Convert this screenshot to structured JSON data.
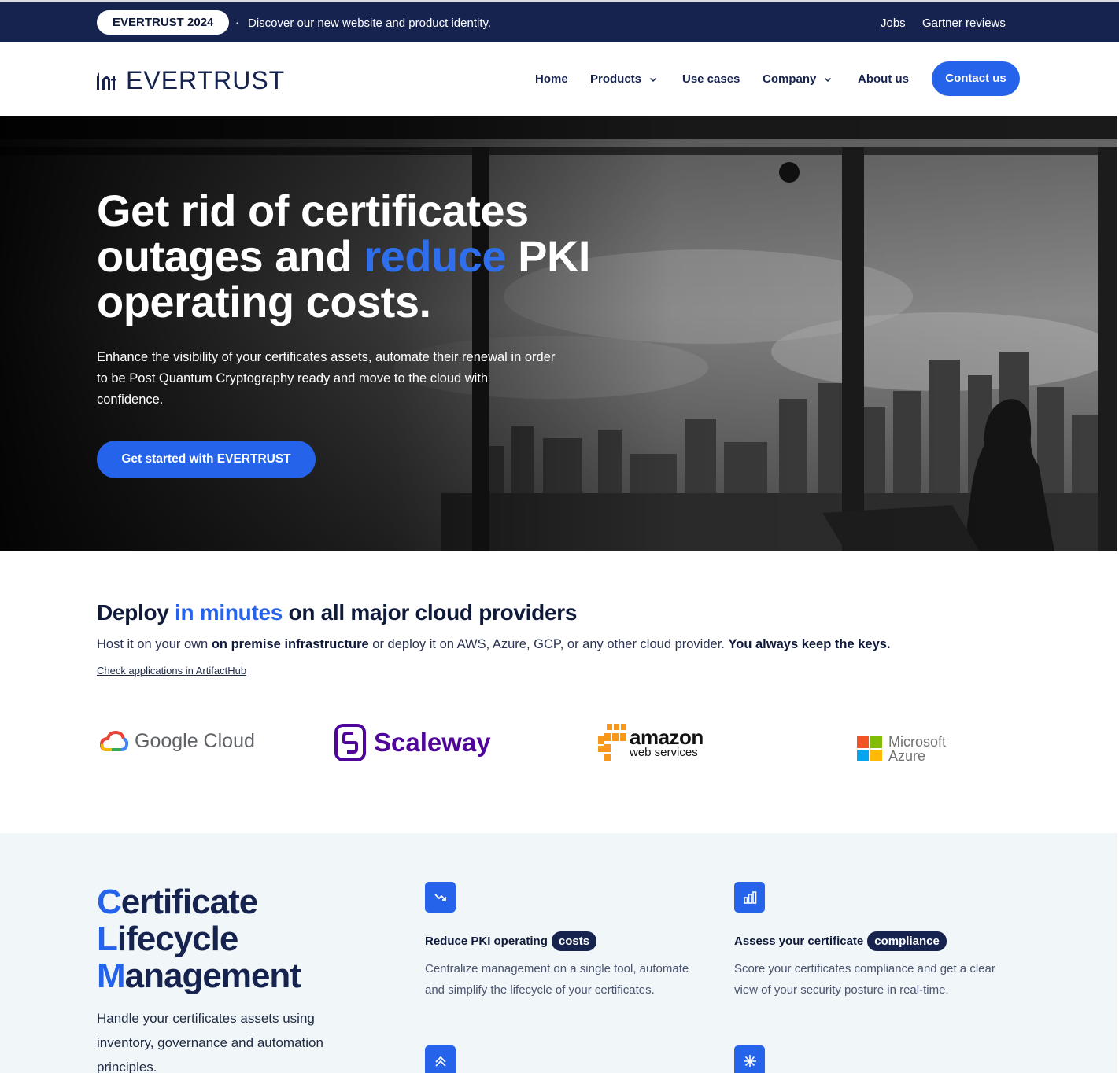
{
  "topbar": {
    "badge": "EVERTRUST 2024",
    "separator": "·",
    "announcement": "Discover our new website and product identity.",
    "links": [
      "Jobs",
      "Gartner reviews"
    ]
  },
  "header": {
    "logo_text": "EVERTRUST",
    "nav": [
      "Home",
      "Products",
      "Use cases",
      "Company",
      "About us"
    ],
    "contact": "Contact us"
  },
  "hero": {
    "title_part1": "Get rid of certificates outages and ",
    "title_accent": "reduce",
    "title_part2": " PKI operating costs.",
    "description": "Enhance the visibility of your certificates assets, automate their renewal in order to be Post Quantum Cryptography ready and move to the cloud with confidence.",
    "cta": "Get started with EVERTRUST"
  },
  "deploy": {
    "title_part1": "Deploy ",
    "title_accent": "in minutes",
    "title_part2": " on all major cloud providers",
    "sub_part1": "Host it on your own ",
    "sub_bold1": "on premise infrastructure",
    "sub_part2": " or deploy it on AWS, Azure, GCP, or any other cloud provider. ",
    "sub_bold2": "You always keep the keys.",
    "link": "Check applications in ArtifactHub",
    "providers": {
      "google": "Google Cloud",
      "scaleway": "Scaleway",
      "amazon": "amazon",
      "amazon_sub": "web services",
      "microsoft_line1": "Microsoft",
      "microsoft_line2": "Azure"
    }
  },
  "clm": {
    "title_cap1": "C",
    "title_rest1": "ertificate",
    "title_cap2": "L",
    "title_rest2": "ifecycle",
    "title_cap3": "M",
    "title_rest3": "anagement",
    "description": "Handle your certificates assets using inventory, governance and automation principles.",
    "features": [
      {
        "icon": "trend-down-icon",
        "title": "Reduce PKI operating",
        "badge": "costs",
        "desc": "Centralize management on a single tool, automate and simplify the lifecycle of your certificates."
      },
      {
        "icon": "bar-chart-icon",
        "title": "Assess your certificate",
        "badge": "compliance",
        "desc": "Score your certificates compliance and get a clear view of your security posture in real-time."
      },
      {
        "icon": "double-chevron-up-icon"
      },
      {
        "icon": "sparkle-icon"
      }
    ]
  },
  "colors": {
    "navy": "#16234f",
    "blue": "#2563eb",
    "section_bg": "#f1f7f9"
  }
}
